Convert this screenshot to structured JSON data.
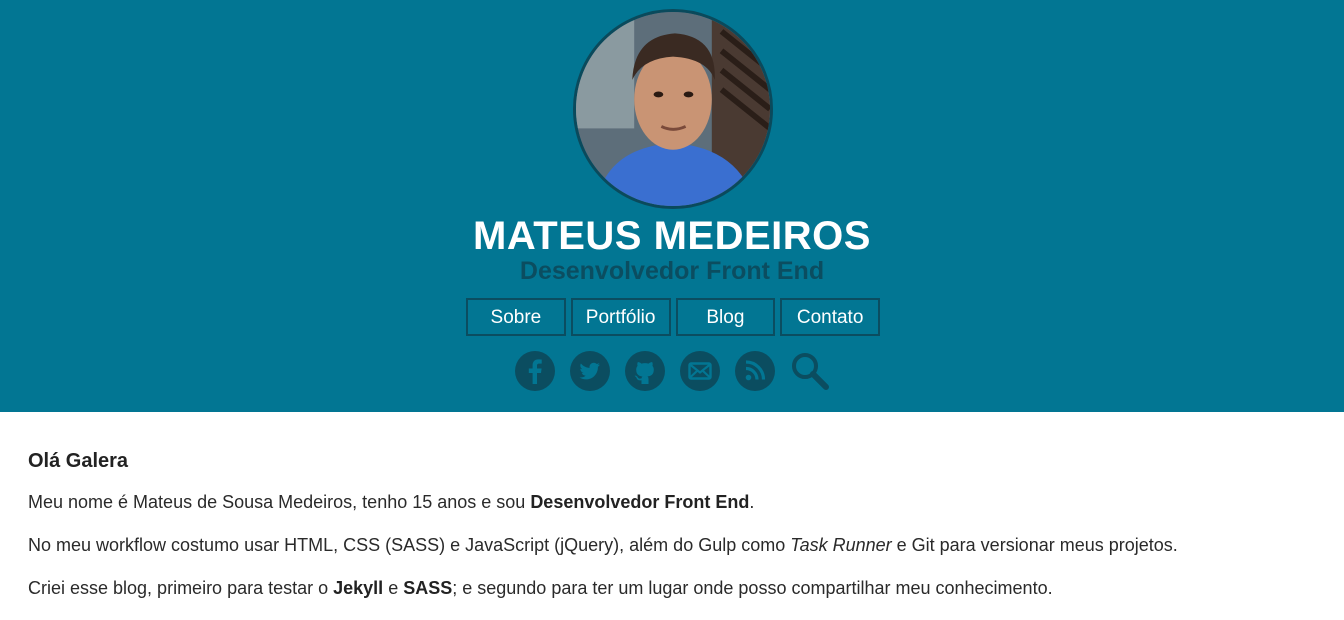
{
  "header": {
    "name": "MATEUS MEDEIROS",
    "subtitle": "Desenvolvedor Front End",
    "nav": [
      {
        "label": "Sobre"
      },
      {
        "label": "Portfólio"
      },
      {
        "label": "Blog"
      },
      {
        "label": "Contato"
      }
    ],
    "social_icons": [
      "facebook-icon",
      "twitter-icon",
      "github-icon",
      "email-icon",
      "rss-icon",
      "search-icon"
    ],
    "colors": {
      "background": "#027693",
      "accent_dark": "#0b4d60",
      "text_light": "#ffffff"
    }
  },
  "content": {
    "heading": "Olá Galera",
    "p1": {
      "before": "Meu nome é Mateus de Sousa Medeiros, tenho 15 anos e sou ",
      "bold": "Desenvolvedor Front End",
      "after": "."
    },
    "p2": {
      "before": "No meu workflow costumo usar HTML, CSS (SASS) e JavaScript (jQuery), além do Gulp como ",
      "italic": "Task Runner",
      "after": " e Git para versionar meus projetos."
    },
    "p3": {
      "before": "Criei esse blog, primeiro para testar o ",
      "bold1": "Jekyll",
      "mid": " e ",
      "bold2": "SASS",
      "after": "; e segundo para ter um lugar onde posso compartilhar meu conhecimento."
    }
  }
}
